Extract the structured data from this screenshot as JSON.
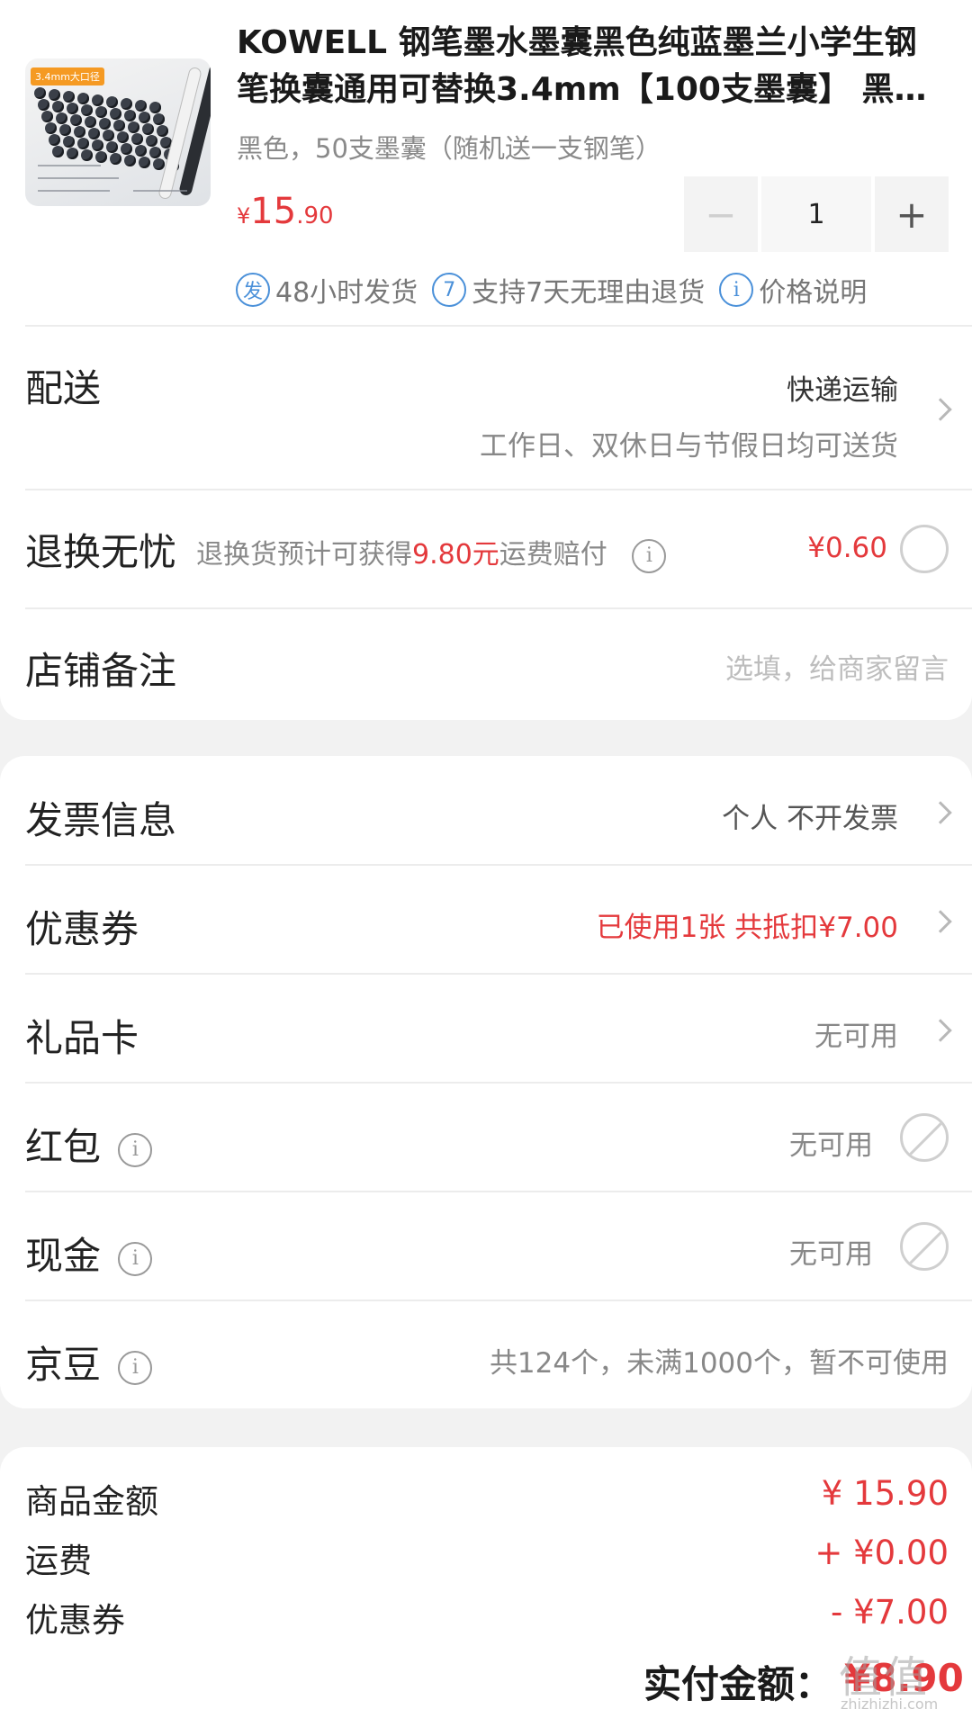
{
  "product": {
    "title": "KOWELL 钢笔墨水墨囊黑色纯蓝墨兰小学生钢笔换囊通用可替换3.4mm【100支墨囊】 黑色，50支墨囊（随机送一支钢笔）",
    "variant": "黑色，50支墨囊（随机送一支钢笔）",
    "price_currency": "¥",
    "price_int": "15",
    "price_dec": ".90",
    "quantity": "1",
    "minus_label": "−",
    "plus_label": "+",
    "thumb_tag": "3.4mm大口径",
    "badges": [
      {
        "icon": "发",
        "text": "48小时发货"
      },
      {
        "icon": "7",
        "text": "支持7天无理由退货"
      },
      {
        "icon": "i",
        "text": "价格说明"
      }
    ]
  },
  "delivery": {
    "label": "配送",
    "method": "快递运输",
    "note": "工作日、双休日与节假日均可送货"
  },
  "return_worry": {
    "label": "退换无忧",
    "desc_prefix": "退换货预计可获得",
    "desc_amount": "9.80元",
    "desc_suffix": "运费赔付",
    "price": "¥0.60"
  },
  "store_note": {
    "label": "店铺备注",
    "placeholder": "选填，给商家留言"
  },
  "options": {
    "invoice": {
      "label": "发票信息",
      "value": "个人 不开发票"
    },
    "coupon": {
      "label": "优惠券",
      "value": "已使用1张 共抵扣¥7.00"
    },
    "gift_card": {
      "label": "礼品卡",
      "value": "无可用"
    },
    "red_packet": {
      "label": "红包",
      "value": "无可用"
    },
    "cash": {
      "label": "现金",
      "value": "无可用"
    },
    "jd_beans": {
      "label": "京豆",
      "value": "共124个，未满1000个，暂不可使用"
    }
  },
  "summary": {
    "goods_label": "商品金额",
    "goods_value": "¥ 15.90",
    "shipping_label": "运费",
    "shipping_value": "+ ¥0.00",
    "coupon_label": "优惠券",
    "coupon_value": "- ¥7.00",
    "total_label": "实付金额：",
    "total_value": "¥8.90"
  },
  "watermark": {
    "main": "值值值",
    "sub": "zhizhizhi.com"
  },
  "colors": {
    "accent_red": "#e4393c",
    "badge_blue": "#4a90d9"
  }
}
